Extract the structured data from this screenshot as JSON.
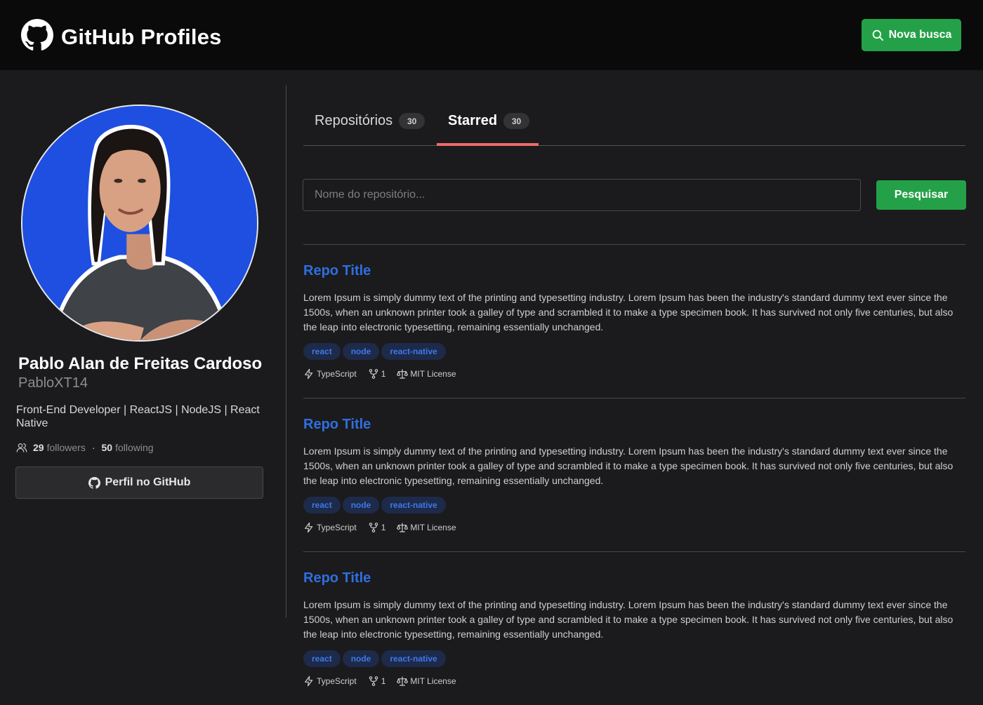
{
  "header": {
    "brand_title": "GitHub Profiles",
    "new_search_label": "Nova busca"
  },
  "profile": {
    "name": "Pablo Alan de Freitas Cardoso",
    "login": "PabloXT14",
    "bio": "Front-End Developer | ReactJS | NodeJS | React Native",
    "followers_count": "29",
    "followers_label": "followers",
    "following_count": "50",
    "following_label": "following",
    "github_button_label": "Perfil no GitHub"
  },
  "tabs": [
    {
      "label": "Repositórios",
      "count": "30",
      "active": false
    },
    {
      "label": "Starred",
      "count": "30",
      "active": true
    }
  ],
  "search": {
    "placeholder": "Nome do repositório...",
    "button_label": "Pesquisar"
  },
  "repos": [
    {
      "title": "Repo Title",
      "description": "Lorem Ipsum is simply dummy text of the printing and typesetting industry. Lorem Ipsum has been the industry's standard dummy text ever since the 1500s, when an unknown printer took a galley of type and scrambled it to make a type specimen book. It has survived not only five centuries, but also the leap into electronic typesetting, remaining essentially unchanged.",
      "topics": [
        "react",
        "node",
        "react-native"
      ],
      "language": "TypeScript",
      "forks": "1",
      "license": "MIT License"
    },
    {
      "title": "Repo Title",
      "description": "Lorem Ipsum is simply dummy text of the printing and typesetting industry. Lorem Ipsum has been the industry's standard dummy text ever since the 1500s, when an unknown printer took a galley of type and scrambled it to make a type specimen book. It has survived not only five centuries, but also the leap into electronic typesetting, remaining essentially unchanged.",
      "topics": [
        "react",
        "node",
        "react-native"
      ],
      "language": "TypeScript",
      "forks": "1",
      "license": "MIT License"
    },
    {
      "title": "Repo Title",
      "description": "Lorem Ipsum is simply dummy text of the printing and typesetting industry. Lorem Ipsum has been the industry's standard dummy text ever since the 1500s, when an unknown printer took a galley of type and scrambled it to make a type specimen book. It has survived not only five centuries, but also the leap into electronic typesetting, remaining essentially unchanged.",
      "topics": [
        "react",
        "node",
        "react-native"
      ],
      "language": "TypeScript",
      "forks": "1",
      "license": "MIT License"
    }
  ],
  "colors": {
    "accent_green": "#24a148",
    "link_blue": "#2f6fe0",
    "tab_underline": "#f06a6a",
    "avatar_background": "#1f4fe0"
  },
  "icons": {
    "brand": "github-icon",
    "new_search": "search-icon",
    "followers": "users-icon",
    "profile_button": "github-icon",
    "language": "lightning-icon",
    "forks": "git-fork-icon",
    "license": "scale-icon"
  }
}
